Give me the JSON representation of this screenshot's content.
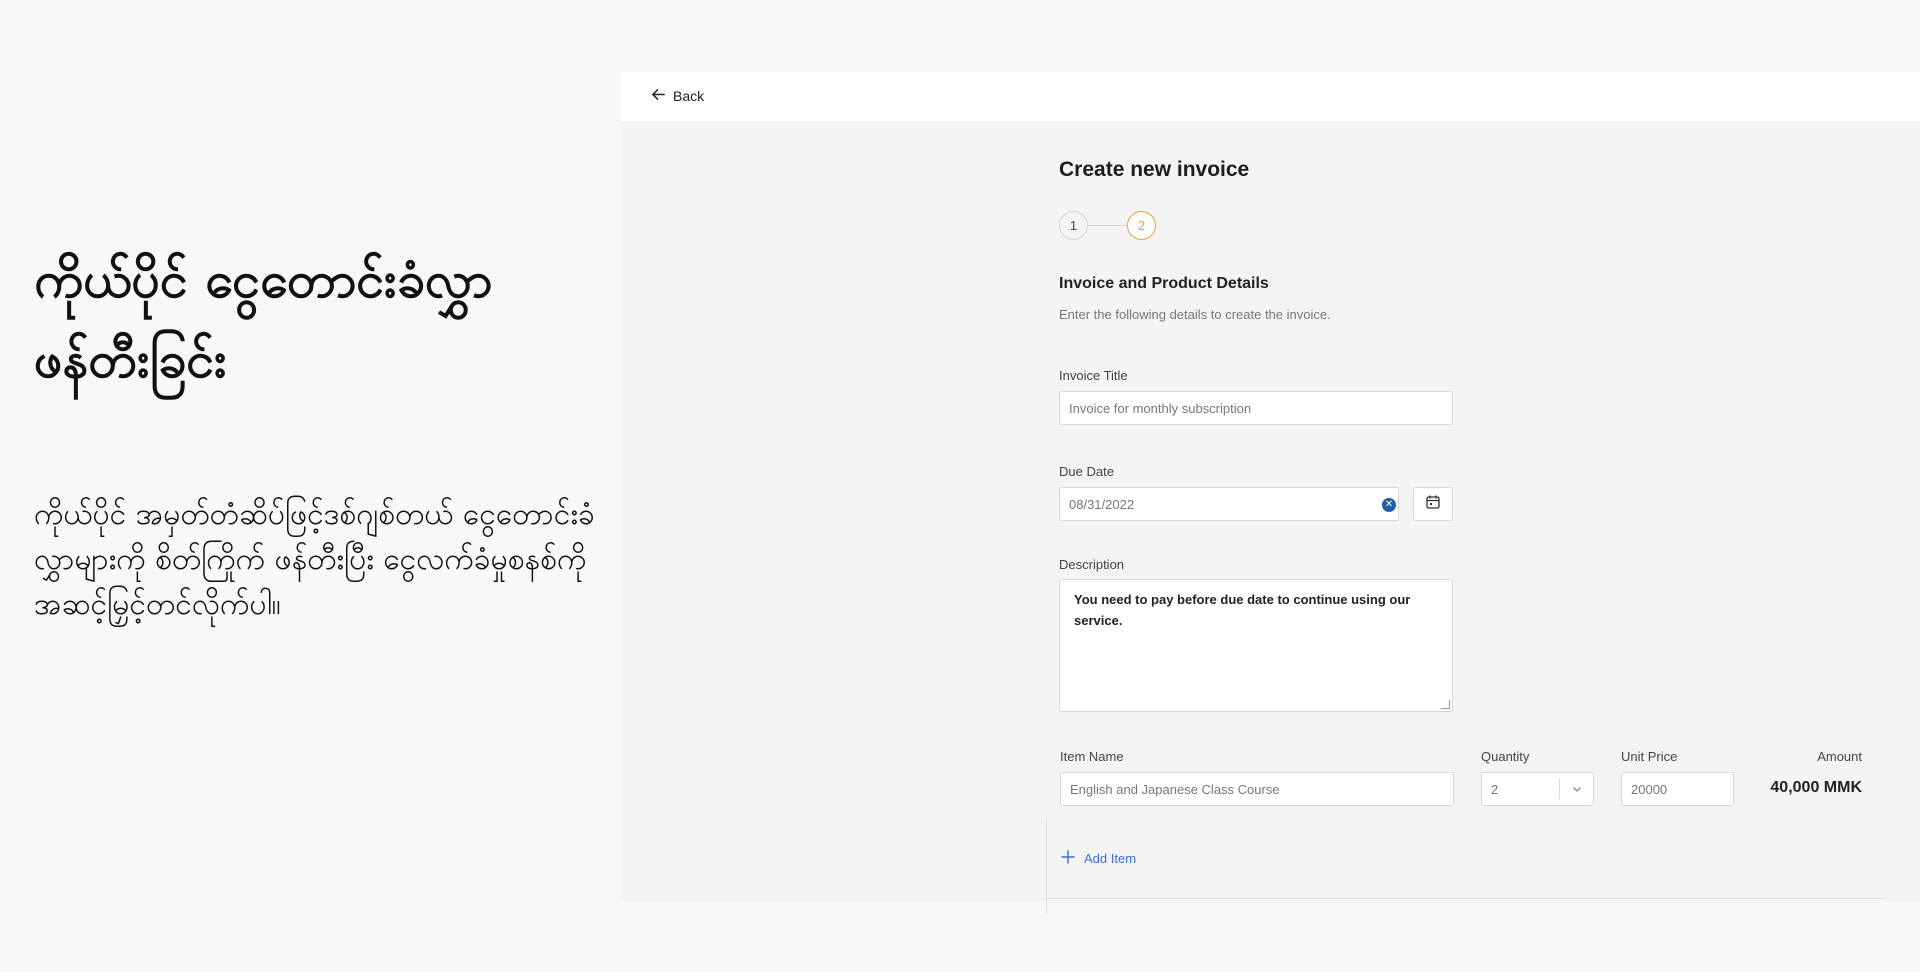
{
  "hero": {
    "title": "ကိုယ်ပိုင် ငွေတောင်းခံလွှာ ဖန်တီးခြင်း",
    "description": "ကိုယ်ပိုင် အမှတ်တံဆိပ်ဖြင့်ဒစ်ဂျစ်တယ် ငွေတောင်းခံလွှာများကို စိတ်ကြိုက် ဖန်တီးပြီး ငွေလက်ခံမှုစနစ်ကို အဆင့်မြှင့်တင်လိုက်ပါ။"
  },
  "topbar": {
    "back_label": "Back"
  },
  "form": {
    "page_title": "Create new invoice",
    "steps": [
      "1",
      "2"
    ],
    "active_step": 2,
    "section_title": "Invoice and Product Details",
    "section_subtitle": "Enter the following details to create the invoice.",
    "invoice_title": {
      "label": "Invoice Title",
      "value": "Invoice for monthly subscription"
    },
    "due_date": {
      "label": "Due Date",
      "value": "08/31/2022"
    },
    "description": {
      "label": "Description",
      "value": "You need to pay before due date to continue using our service."
    },
    "items": {
      "headers": {
        "item_name": "Item Name",
        "quantity": "Quantity",
        "unit_price": "Unit Price",
        "amount": "Amount"
      },
      "rows": [
        {
          "item_name": "English and Japanese Class Course",
          "quantity": "2",
          "unit_price": "20000",
          "amount": "40,000 MMK"
        }
      ],
      "add_label": "Add Item"
    }
  },
  "colors": {
    "accent": "#e4a43a",
    "link": "#3a6fd8",
    "clear": "#1d5fa8"
  }
}
